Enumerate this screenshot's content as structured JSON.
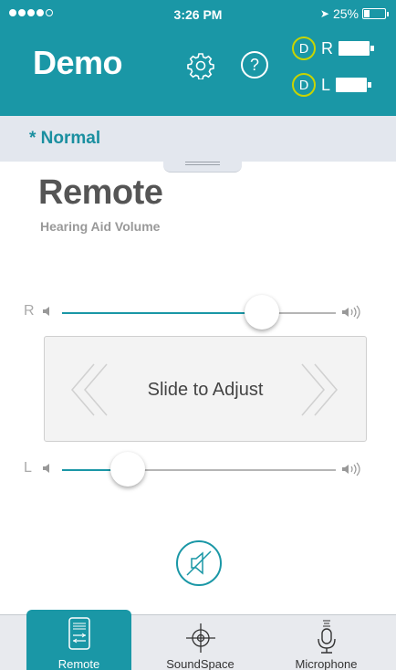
{
  "status_bar": {
    "time": "3:26 PM",
    "battery_percent": "25%",
    "battery_level": 0.25,
    "signal_bars_filled": 4,
    "signal_bars_total": 5
  },
  "header": {
    "title": "Demo",
    "settings_icon": "gear-icon",
    "help_icon": "question-icon",
    "help_glyph": "?",
    "devices": [
      {
        "side": "R",
        "icon": "bluetooth-icon"
      },
      {
        "side": "L",
        "icon": "bluetooth-icon"
      }
    ]
  },
  "program": {
    "label": "* Normal"
  },
  "page": {
    "title": "Remote",
    "subtitle": "Hearing Aid Volume"
  },
  "sliders": {
    "right": {
      "side": "R",
      "value": 0.73
    },
    "left": {
      "side": "L",
      "value": 0.24
    }
  },
  "adjust_panel": {
    "label": "Slide to Adjust"
  },
  "mute_icon": "speaker-muted-icon",
  "tabs": [
    {
      "label": "Remote",
      "icon": "remote-icon",
      "active": true
    },
    {
      "label": "SoundSpace",
      "icon": "crosshair-icon",
      "active": false
    },
    {
      "label": "Microphone",
      "icon": "microphone-icon",
      "active": false
    }
  ],
  "colors": {
    "accent": "#1a97a6",
    "bluetooth_ring": "#c8d400",
    "program_bar": "#e3e7ee"
  }
}
